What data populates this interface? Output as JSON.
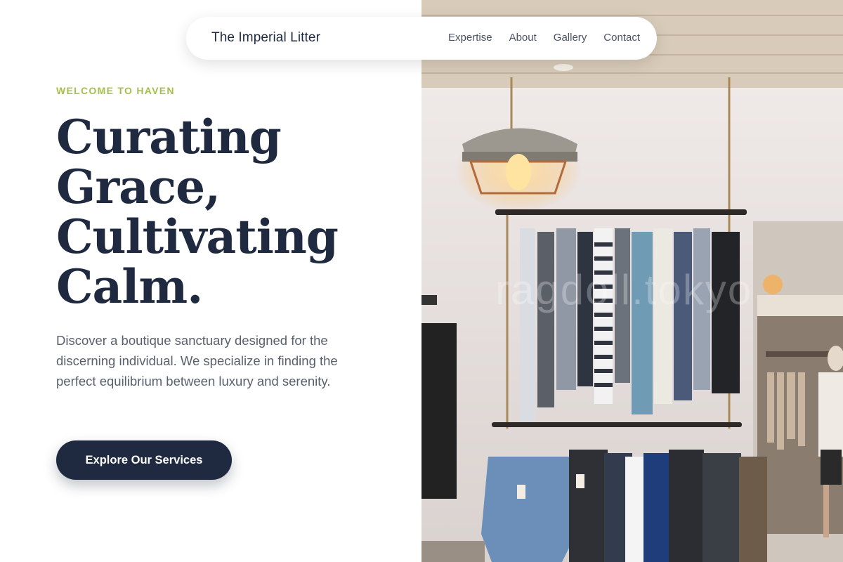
{
  "nav": {
    "brand": "The Imperial Litter",
    "links": [
      "Expertise",
      "About",
      "Gallery",
      "Contact"
    ]
  },
  "hero": {
    "eyebrow": "WELCOME TO HAVEN",
    "headline_lines": [
      "Curating",
      "Grace,",
      "Cultivating",
      "Calm."
    ],
    "description": "Discover a boutique sanctuary designed for the discerning individual. We specialize in finding the perfect equilibrium between luxury and serenity.",
    "cta_label": "Explore Our Services"
  },
  "photo": {
    "watermark": "ragdoll.tokyo"
  },
  "colors": {
    "accent": "#a3bf4c",
    "navy": "#1f2a40",
    "body_text": "#59606d"
  }
}
